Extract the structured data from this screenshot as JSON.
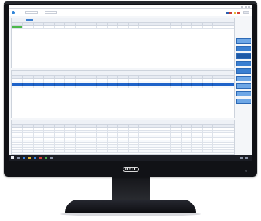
{
  "monitor": {
    "brand": "DELL"
  },
  "window": {
    "title": "",
    "toolbar": {
      "exit_label": ""
    }
  },
  "panels": {
    "top": {
      "title": "",
      "meta1": "",
      "meta2": "",
      "headers": [
        "",
        "",
        "",
        "",
        "",
        "",
        "",
        "",
        "",
        "",
        "",
        "",
        "",
        "",
        "",
        "",
        "",
        "",
        "",
        "",
        ""
      ],
      "rows": [
        [
          "",
          "",
          "",
          "",
          "",
          "",
          "",
          "",
          "",
          "",
          "",
          "",
          "",
          "",
          "",
          "",
          "",
          "",
          "",
          "",
          ""
        ]
      ]
    },
    "middle": {
      "title": "",
      "meta1": "",
      "meta2": "",
      "headers": [
        "",
        "",
        "",
        "",
        "",
        "",
        "",
        "",
        "",
        "",
        "",
        "",
        "",
        "",
        "",
        "",
        "",
        "",
        "",
        "",
        ""
      ],
      "rows": [
        [
          "",
          "",
          "",
          "",
          "",
          "",
          "",
          "",
          "",
          "",
          "",
          "",
          "",
          "",
          "",
          "",
          "",
          "",
          "",
          "",
          ""
        ],
        [
          "",
          "",
          "",
          "",
          "",
          "",
          "",
          "",
          "",
          "",
          "",
          "",
          "",
          "",
          "",
          "",
          "",
          "",
          "",
          "",
          ""
        ],
        [
          "",
          "",
          "",
          "",
          "",
          "",
          "",
          "",
          "",
          "",
          "",
          "",
          "",
          "",
          "",
          "",
          "",
          "",
          "",
          "",
          ""
        ],
        [
          "",
          "",
          "",
          "",
          "",
          "",
          "",
          "",
          "",
          "",
          "",
          "",
          "",
          "",
          "",
          "",
          "",
          "",
          "",
          "",
          ""
        ]
      ]
    },
    "bottom": {
      "title": "",
      "meta1": "",
      "meta2": "",
      "headers": [
        "",
        "",
        "",
        "",
        "",
        "",
        "",
        "",
        "",
        "",
        "",
        "",
        "",
        "",
        "",
        "",
        "",
        "",
        "",
        "",
        ""
      ],
      "rows": [
        [
          "",
          "",
          "",
          "",
          "",
          "",
          "",
          "",
          "",
          "",
          "",
          "",
          "",
          "",
          "",
          "",
          "",
          "",
          "",
          "",
          ""
        ],
        [
          "",
          "",
          "",
          "",
          "",
          "",
          "",
          "",
          "",
          "",
          "",
          "",
          "",
          "",
          "",
          "",
          "",
          "",
          "",
          "",
          ""
        ],
        [
          "",
          "",
          "",
          "",
          "",
          "",
          "",
          "",
          "",
          "",
          "",
          "",
          "",
          "",
          "",
          "",
          "",
          "",
          "",
          "",
          ""
        ],
        [
          "",
          "",
          "",
          "",
          "",
          "",
          "",
          "",
          "",
          "",
          "",
          "",
          "",
          "",
          "",
          "",
          "",
          "",
          "",
          "",
          ""
        ],
        [
          "",
          "",
          "",
          "",
          "",
          "",
          "",
          "",
          "",
          "",
          "",
          "",
          "",
          "",
          "",
          "",
          "",
          "",
          "",
          "",
          ""
        ],
        [
          "",
          "",
          "",
          "",
          "",
          "",
          "",
          "",
          "",
          "",
          "",
          "",
          "",
          "",
          "",
          "",
          "",
          "",
          "",
          "",
          ""
        ],
        [
          "",
          "",
          "",
          "",
          "",
          "",
          "",
          "",
          "",
          "",
          "",
          "",
          "",
          "",
          "",
          "",
          "",
          "",
          "",
          "",
          ""
        ],
        [
          "",
          "",
          "",
          "",
          "",
          "",
          "",
          "",
          "",
          "",
          "",
          "",
          "",
          "",
          "",
          "",
          "",
          "",
          "",
          "",
          ""
        ],
        [
          "",
          "",
          "",
          "",
          "",
          "",
          "",
          "",
          "",
          "",
          "",
          "",
          "",
          "",
          "",
          "",
          "",
          "",
          "",
          "",
          ""
        ],
        [
          "",
          "",
          "",
          "",
          "",
          "",
          "",
          "",
          "",
          "",
          "",
          "",
          "",
          "",
          "",
          "",
          "",
          "",
          "",
          "",
          ""
        ]
      ]
    }
  },
  "sidebar": {
    "buttons": [
      "",
      "",
      "",
      "",
      "",
      "",
      "",
      "",
      ""
    ]
  },
  "colors": {
    "accent": "#3a7fd1",
    "selected_row": "#1f63c9",
    "status_green": "#4cb84a"
  }
}
